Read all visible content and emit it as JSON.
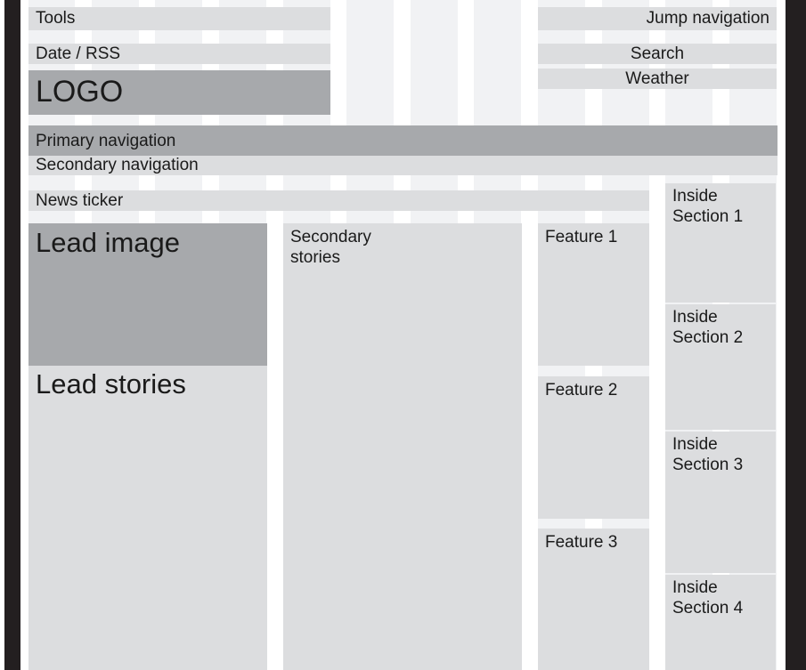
{
  "labels": {
    "tools": "Tools",
    "date_rss": "Date / RSS",
    "logo": "LOGO",
    "jump_navigation": "Jump navigation",
    "search": "Search",
    "weather": "Weather",
    "primary_navigation": "Primary navigation",
    "secondary_navigation": "Secondary navigation",
    "news_ticker": "News ticker",
    "lead_image": "Lead image",
    "lead_stories": "Lead stories",
    "secondary_stories": "Secondary stories",
    "features": [
      "Feature 1",
      "Feature 2",
      "Feature 3"
    ],
    "inside_sections": [
      "Inside Section 1",
      "Inside Section 2",
      "Inside Section 3",
      "Inside Section 4"
    ]
  },
  "colors": {
    "frame": "#231f20",
    "grid_column": "#f1f2f4",
    "block_light": "#dcdddf",
    "block_dark": "#a7a9ac",
    "text": "#1a1a1a"
  }
}
